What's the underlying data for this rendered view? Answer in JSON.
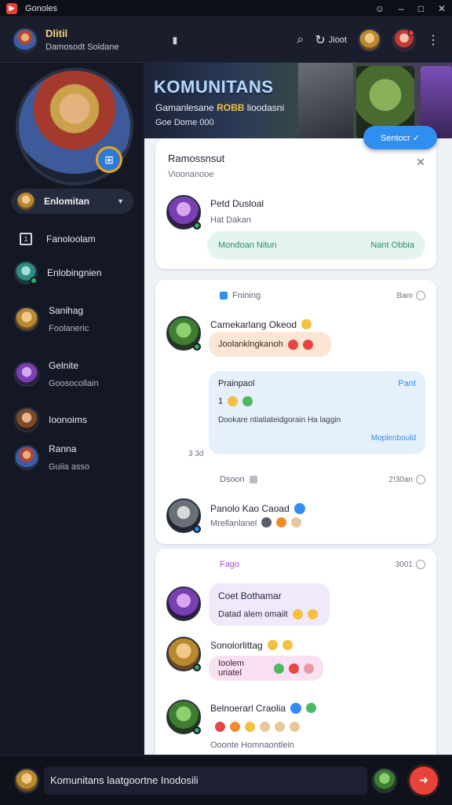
{
  "window": {
    "title": "Gonoles",
    "controls": [
      "☺",
      "–",
      "□",
      "✕"
    ]
  },
  "header": {
    "name": "Dlitil",
    "subtitle": "Damosodt Soidane",
    "center_label": "▮",
    "stat_label": "Jioot"
  },
  "sidebar": {
    "selected": "Enlomitan",
    "items": [
      {
        "label": "Fanoloolam",
        "sub": ""
      },
      {
        "label": "Enlobingnien",
        "sub": ""
      },
      {
        "label": "Sanihag",
        "sub": "Foolaneric"
      },
      {
        "label": "Gelnite",
        "sub": "Goosocollain"
      },
      {
        "label": "Ioonoims",
        "sub": ""
      },
      {
        "label": "Ranna",
        "sub": "Guiia asso"
      }
    ]
  },
  "banner": {
    "title": "KOMUNITANS",
    "subtitle_a": "Gamanlesane",
    "subtitle_b": "ROBB",
    "subtitle_c": "lioodasni",
    "line2": "Goe Dome 000"
  },
  "join_button": "Sentocr ✓",
  "card1": {
    "title": "Ramossnsut",
    "subtitle": "Vioonanooe",
    "user_name": "Petd Dusloal",
    "user_sub": "Hat Dakan",
    "pill_left": "Mondoan Nitun",
    "pill_right": "Nant Obbia"
  },
  "card2": {
    "section": "Fnining",
    "time1": "Bam",
    "user1_name": "Camekarlang Okeod",
    "user1_bubble": "Joolanklngkanoh",
    "quote_title": "Prainpaol",
    "quote_action": "Pant",
    "quote_count": "1",
    "quote_body": "Dookare ntiatiateidgorain Ha laggin",
    "quote_link": "Moplenbould",
    "side_time": "3 3d",
    "section2": "Dsoon",
    "time2": "2!30an",
    "user2_name": "Panolo Kao Caoad",
    "user2_sub": "Mrellanlanel"
  },
  "card3": {
    "section": "Fago",
    "time": "3001",
    "user1_name": "Coet Bothamar",
    "user1_bubble": "Datad alem omaiit",
    "user2_name": "Sonolorlittag",
    "user2_bubble": "Ioolem uriatel",
    "user3_name": "Belnoerarl Craolia",
    "user3_sub": "Ooonte Homnaontlein"
  },
  "composer": {
    "value": "Komunitans laatgoortne Inodosili",
    "placeholder": ""
  },
  "colors": {
    "accent": "#2f8ef0",
    "brand": "#e8423a",
    "gold": "#f4d27a"
  },
  "icons": [
    "app-logo-icon",
    "search-icon",
    "refresh-icon",
    "more-vertical-icon",
    "chevron-down-icon",
    "square-icon",
    "close-icon",
    "clock-icon",
    "verified-icon",
    "send-icon"
  ]
}
